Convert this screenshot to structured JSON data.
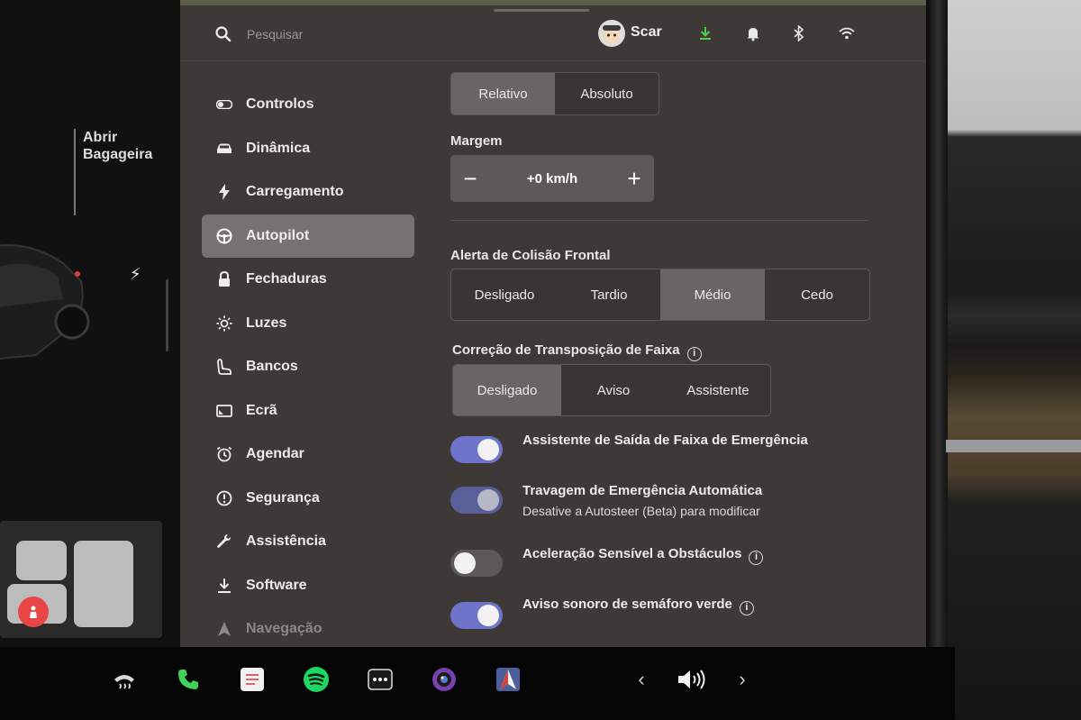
{
  "search": {
    "placeholder": "Pesquisar"
  },
  "user": {
    "name": "Scar"
  },
  "status_icons": [
    "download-icon",
    "bell-icon",
    "bluetooth-icon",
    "wifi-icon"
  ],
  "colors": {
    "accent_toggle": "#6d74c9",
    "download_green": "#4fd14f",
    "alert_red": "#e84545",
    "phone_green": "#3fd35a",
    "spotify_green": "#1ed760"
  },
  "car": {
    "trunk_label": "Abrir\nBagageira"
  },
  "sidebar": {
    "items": [
      {
        "label": "Controlos",
        "icon": "toggle-icon"
      },
      {
        "label": "Dinâmica",
        "icon": "car-icon"
      },
      {
        "label": "Carregamento",
        "icon": "bolt-icon"
      },
      {
        "label": "Autopilot",
        "icon": "steering-wheel-icon",
        "active": true
      },
      {
        "label": "Fechaduras",
        "icon": "lock-icon"
      },
      {
        "label": "Luzes",
        "icon": "sun-icon"
      },
      {
        "label": "Bancos",
        "icon": "seat-icon"
      },
      {
        "label": "Ecrã",
        "icon": "display-icon"
      },
      {
        "label": "Agendar",
        "icon": "alarm-clock-icon"
      },
      {
        "label": "Segurança",
        "icon": "exclamation-circle-icon"
      },
      {
        "label": "Assistência",
        "icon": "wrench-icon"
      },
      {
        "label": "Software",
        "icon": "download-icon"
      },
      {
        "label": "Navegação",
        "icon": "navigation-arrow-icon"
      }
    ]
  },
  "speed_mode": {
    "options": [
      "Relativo",
      "Absoluto"
    ],
    "selected": "Relativo"
  },
  "margin": {
    "title": "Margem",
    "value": "+0 km/h",
    "minus": "−",
    "plus": "+"
  },
  "collision_warning": {
    "title": "Alerta de Colisão Frontal",
    "options": [
      "Desligado",
      "Tardio",
      "Médio",
      "Cedo"
    ],
    "selected": "Médio"
  },
  "lane_departure": {
    "title": "Correção de Transposição de Faixa",
    "info": "i",
    "options": [
      "Desligado",
      "Aviso",
      "Assistente"
    ],
    "selected": "Desligado"
  },
  "toggles": [
    {
      "label": "Assistente de Saída de Faixa de Emergência",
      "state": "on"
    },
    {
      "label": "Travagem de Emergência Automática",
      "sub": "Desative a Autosteer (Beta) para modificar",
      "state": "on-disabled"
    },
    {
      "label": "Aceleração Sensível a Obstáculos",
      "state": "off",
      "info": "i"
    },
    {
      "label": "Aviso sonoro de semáforo verde",
      "state": "on",
      "info": "i"
    }
  ],
  "taskbar": {
    "icons": [
      "defrost-icon",
      "phone-icon",
      "notes-icon",
      "spotify-icon",
      "more-icon",
      "camera-icon",
      "navigation-app-icon"
    ],
    "volume": {
      "prev": "‹",
      "next": "›",
      "icon": "volume-icon"
    }
  }
}
